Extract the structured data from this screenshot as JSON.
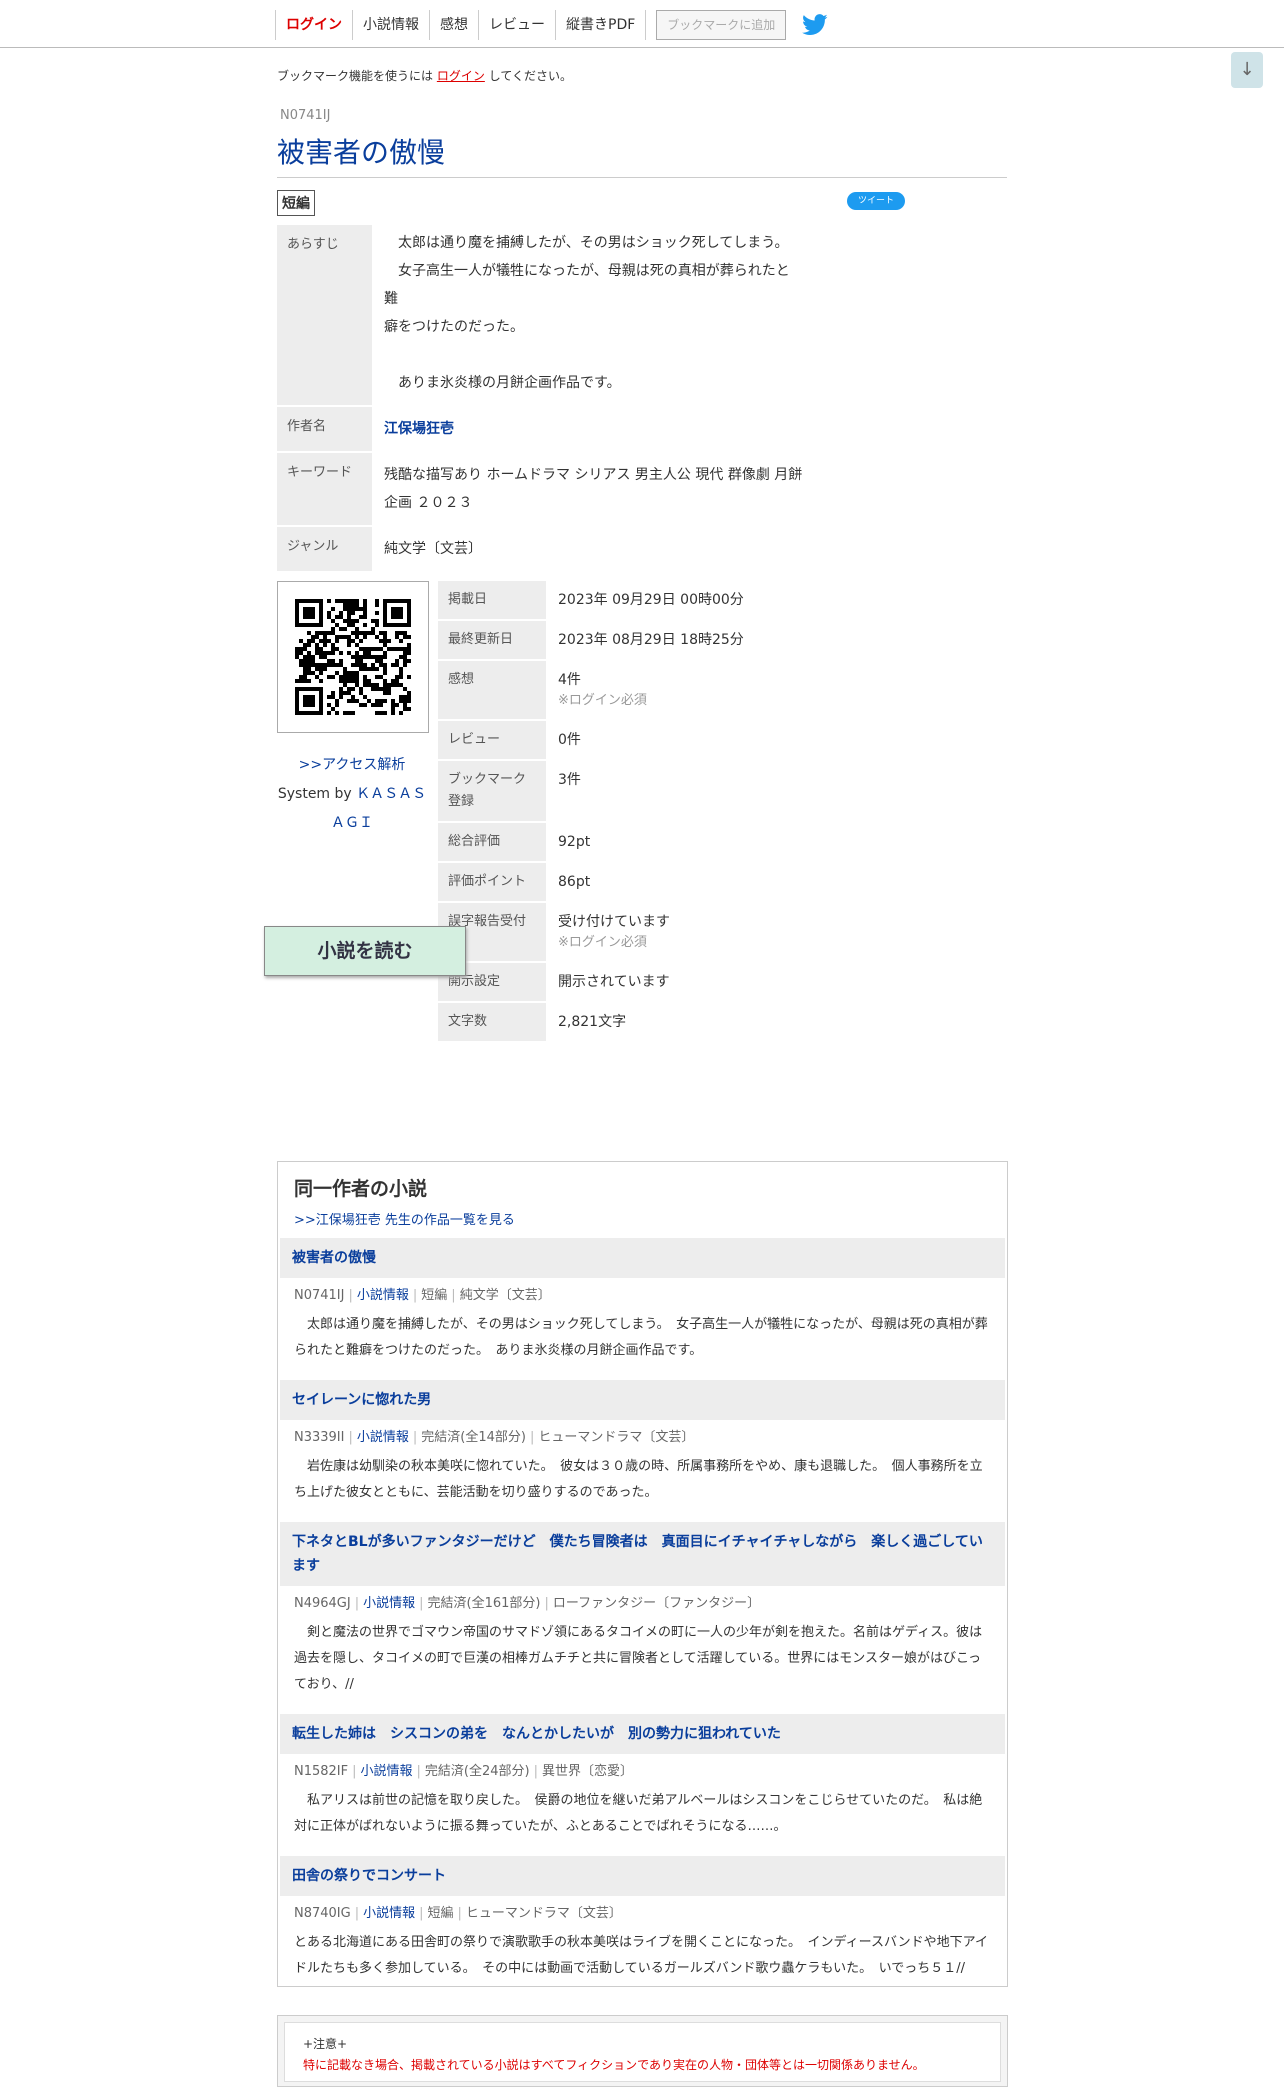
{
  "nav": {
    "items": [
      "ログイン",
      "小説情報",
      "感想",
      "レビュー",
      "縦書きPDF"
    ],
    "bookmark_button": "ブックマークに追加"
  },
  "scroll_down": "↓",
  "notice": {
    "prefix": "ブックマーク機能を使うには",
    "link": "ログイン",
    "suffix": "してください。"
  },
  "novel": {
    "ncode": "N0741IJ",
    "title": "被害者の傲慢",
    "type_tag": "短編",
    "tweet_label": "ツイート",
    "synopsis_label": "あらすじ",
    "synopsis": [
      "　太郎は通り魔を捕縛したが、その男はショック死してしまう。",
      "　女子高生一人が犠牲になったが、母親は死の真相が葬られたと難",
      "癖をつけたのだった。",
      "",
      "　ありま氷炎様の月餅企画作品です。"
    ],
    "author_label": "作者名",
    "author": "江保場狂壱",
    "keyword_label": "キーワード",
    "keywords": "残酷な描写あり ホームドラマ シリアス 男主人公 現代 群像劇 月餅企画 ２０２３",
    "genre_label": "ジャンル",
    "genre": "純文学〔文芸〕"
  },
  "qr": {
    "access_link": ">>アクセス解析",
    "system_by": "System by",
    "system_name_1": "ＫＡＳＡＳ",
    "system_name_2": "ＡＧＩ"
  },
  "stats": [
    {
      "label": "掲載日",
      "value": "2023年 09月29日 00時00分",
      "sub": ""
    },
    {
      "label": "最終更新日",
      "value": "2023年 08月29日 18時25分",
      "sub": ""
    },
    {
      "label": "感想",
      "value": "4件",
      "sub": "※ログイン必須"
    },
    {
      "label": "レビュー",
      "value": "0件",
      "sub": ""
    },
    {
      "label": "ブックマーク登録",
      "value": "3件",
      "sub": ""
    },
    {
      "label": "総合評価",
      "value": "92pt",
      "sub": ""
    },
    {
      "label": "評価ポイント",
      "value": "86pt",
      "sub": ""
    },
    {
      "label": "誤字報告受付",
      "value": "受け付けています",
      "sub": "※ログイン必須"
    },
    {
      "label": "開示設定",
      "value": "開示されています",
      "sub": ""
    },
    {
      "label": "文字数",
      "value": "2,821文字",
      "sub": ""
    }
  ],
  "read_button": "小説を読む",
  "same_author": {
    "heading": "同一作者の小説",
    "list_link": ">>江保場狂壱 先生の作品一覧を見る",
    "works": [
      {
        "title": "被害者の傲慢",
        "ncode": "N0741IJ",
        "info": "小説情報",
        "status": "短編",
        "genre": "純文学〔文芸〕",
        "desc": "　太郎は通り魔を捕縛したが、その男はショック死してしまう。　女子高生一人が犠牲になったが、母親は死の真相が葬られたと難癖をつけたのだった。　ありま氷炎様の月餅企画作品です。"
      },
      {
        "title": "セイレーンに惚れた男",
        "ncode": "N3339II",
        "info": "小説情報",
        "status": "完結済(全14部分)",
        "genre": "ヒューマンドラマ〔文芸〕",
        "desc": "　岩佐康は幼馴染の秋本美咲に惚れていた。　彼女は３０歳の時、所属事務所をやめ、康も退職した。　個人事務所を立ち上げた彼女とともに、芸能活動を切り盛りするのであった。"
      },
      {
        "title": "下ネタとBLが多いファンタジーだけど　僕たち冒険者は　真面目にイチャイチャしながら　楽しく過ごしています",
        "ncode": "N4964GJ",
        "info": "小説情報",
        "status": "完結済(全161部分)",
        "genre": "ローファンタジー〔ファンタジー〕",
        "desc": "　剣と魔法の世界でゴマウン帝国のサマドゾ領にあるタコイメの町に一人の少年が剣を抱えた。名前はゲディス。彼は過去を隠し、タコイメの町で巨漢の相棒ガムチチと共に冒険者として活躍している。世界にはモンスター娘がはびこっており、//"
      },
      {
        "title": "転生した姉は　シスコンの弟を　なんとかしたいが　別の勢力に狙われていた",
        "ncode": "N1582IF",
        "info": "小説情報",
        "status": "完結済(全24部分)",
        "genre": "異世界〔恋愛〕",
        "desc": "　私アリスは前世の記憶を取り戻した。　侯爵の地位を継いだ弟アルベールはシスコンをこじらせていたのだ。　私は絶対に正体がばれないように振る舞っていたが、ふとあることでばれそうになる……。"
      },
      {
        "title": "田舎の祭りでコンサート",
        "ncode": "N8740IG",
        "info": "小説情報",
        "status": "短編",
        "genre": "ヒューマンドラマ〔文芸〕",
        "desc": "とある北海道にある田舎町の祭りで演歌歌手の秋本美咲はライブを開くことになった。　インディースバンドや地下アイドルたちも多く参加している。　その中には動画で活動しているガールズバンド歌ウ蟲ケラもいた。　いでっち５１//"
      }
    ]
  },
  "caution": {
    "head": "+注意+",
    "body": "特に記載なき場合、掲載されている小説はすべてフィクションであり実在の人物・団体等とは一切関係ありません。"
  },
  "colors": {
    "link": "#0a3e9c",
    "login": "#dd0000",
    "read_button": "#d4efe0"
  }
}
